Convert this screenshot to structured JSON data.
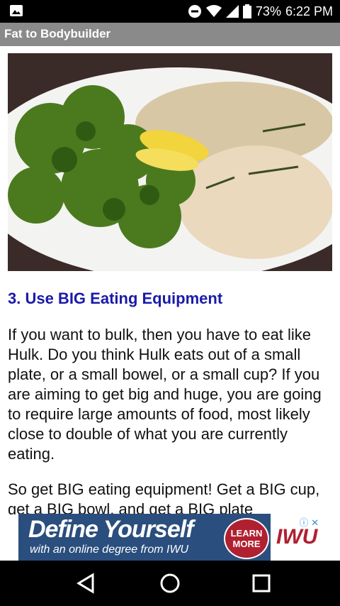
{
  "status_bar": {
    "battery": "73%",
    "time": "6:22 PM",
    "icons": [
      "gallery-icon",
      "dnd-icon",
      "wifi-icon",
      "signal-icon",
      "battery-icon"
    ]
  },
  "app_bar": {
    "title": "Fat to Bodybuilder"
  },
  "article": {
    "image_alt": "Plate with broccoli, lemon, rice and chicken",
    "heading": "3. Use BIG Eating Equipment",
    "paragraph1": "If you want to bulk, then you have to eat like Hulk. Do you think Hulk eats out of a small plate, or a small bowel, or a small cup? If you are aiming to get big and huge, you are going to require large amounts of food, most likely close to double of what you are currently eating.",
    "paragraph2": "So get BIG eating equipment! Get a BIG cup, get a BIG bowl, and get a BIG plate"
  },
  "ad": {
    "headline": "Define Yourself",
    "subline": "with an online degree from IWU",
    "cta": "LEARN MORE",
    "brand": "IWU"
  },
  "nav_bar": {
    "icons": [
      "back-icon",
      "home-icon",
      "recents-icon"
    ]
  },
  "colors": {
    "heading": "#1a1aaa",
    "app_bar": "#8a8a8a",
    "ad_bg": "#2a4e7d"
  }
}
